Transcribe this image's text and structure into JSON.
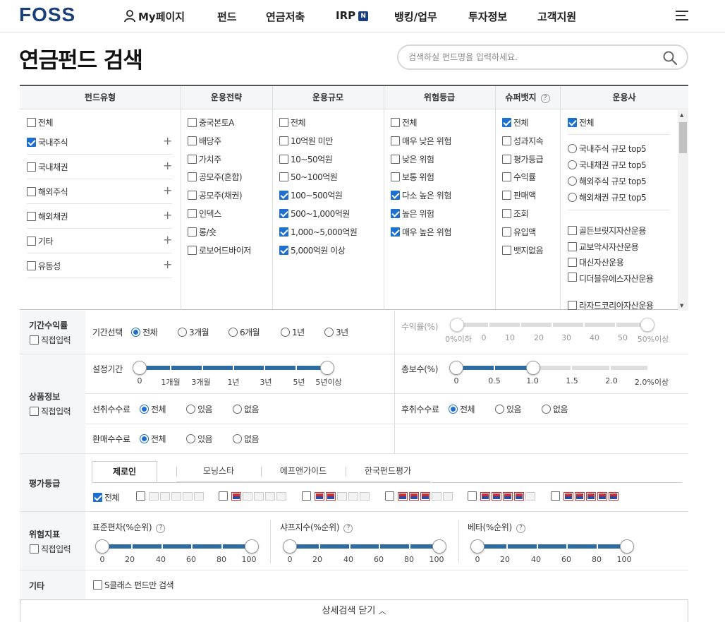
{
  "header": {
    "logo": "FOSS",
    "nav": [
      "My페이지",
      "펀드",
      "연금저축",
      "IRP",
      "뱅킹/업무",
      "투자정보",
      "고객지원"
    ],
    "irp_badge": "N"
  },
  "page": {
    "title": "연금펀드 검색",
    "search_placeholder": "검색하실 펀드명을 입력하세요."
  },
  "filters": {
    "headers": [
      "펀드유형",
      "운용전략",
      "운용규모",
      "위험등급",
      "슈퍼뱃지",
      "운용사"
    ],
    "help_mark": "?",
    "fund_type": [
      {
        "label": "전체",
        "checked": false
      },
      {
        "label": "국내주식",
        "checked": true
      },
      {
        "label": "국내채권",
        "checked": false
      },
      {
        "label": "해외주식",
        "checked": false
      },
      {
        "label": "해외채권",
        "checked": false
      },
      {
        "label": "기타",
        "checked": false
      },
      {
        "label": "유동성",
        "checked": false
      }
    ],
    "plus": "+",
    "strategy": [
      {
        "label": "중국본토A",
        "checked": false
      },
      {
        "label": "배당주",
        "checked": false
      },
      {
        "label": "가치주",
        "checked": false
      },
      {
        "label": "공모주(혼합)",
        "checked": false
      },
      {
        "label": "공모주(채권)",
        "checked": false
      },
      {
        "label": "인덱스",
        "checked": false
      },
      {
        "label": "롱/숏",
        "checked": false
      },
      {
        "label": "로보어드바이저",
        "checked": false
      }
    ],
    "size": [
      {
        "label": "전체",
        "checked": false
      },
      {
        "label": "10억원 미만",
        "checked": false
      },
      {
        "label": "10~50억원",
        "checked": false
      },
      {
        "label": "50~100억원",
        "checked": false
      },
      {
        "label": "100~500억원",
        "checked": true
      },
      {
        "label": "500~1,000억원",
        "checked": true
      },
      {
        "label": "1,000~5,000억원",
        "checked": true
      },
      {
        "label": "5,000억원 이상",
        "checked": true
      }
    ],
    "risk": [
      {
        "label": "전체",
        "checked": false
      },
      {
        "label": "매우 낮은 위험",
        "checked": false
      },
      {
        "label": "낮은 위험",
        "checked": false
      },
      {
        "label": "보통 위험",
        "checked": false
      },
      {
        "label": "다소 높은 위험",
        "checked": true
      },
      {
        "label": "높은 위험",
        "checked": true
      },
      {
        "label": "매우 높은 위험",
        "checked": true
      }
    ],
    "badge": [
      {
        "label": "전체",
        "checked": true
      },
      {
        "label": "성과지속",
        "checked": false
      },
      {
        "label": "평가등급",
        "checked": false
      },
      {
        "label": "수익률",
        "checked": false
      },
      {
        "label": "판매액",
        "checked": false
      },
      {
        "label": "조회",
        "checked": false
      },
      {
        "label": "유입액",
        "checked": false
      },
      {
        "label": "뱃지없음",
        "checked": false
      }
    ],
    "company_all": {
      "label": "전체",
      "checked": true
    },
    "company_top": [
      "국내주식 규모 top5",
      "국내채권 규모 top5",
      "해외주식 규모 top5",
      "해외채권 규모 top5"
    ],
    "company_list": [
      "골든브릿지자산운용",
      "교보악사자산운용",
      "대신자산운용",
      "디더블유에스자산운용",
      "라자드코리아자산운용"
    ]
  },
  "detail": {
    "period_return": {
      "label": "기간수익률",
      "direct": "직접입력",
      "select_label": "기간선택",
      "options": [
        "전체",
        "3개월",
        "6개월",
        "1년",
        "3년"
      ],
      "selected": "전체",
      "rate_label": "수익률(%)",
      "rate_ticks": [
        "0%이하",
        "0",
        "10",
        "20",
        "30",
        "40",
        "50",
        "50%이상"
      ]
    },
    "product": {
      "label": "상품정보",
      "direct": "직접입력",
      "period_label": "설정기간",
      "period_ticks": [
        "0",
        "1개월",
        "3개월",
        "1년",
        "3년",
        "5년",
        "5년이상"
      ],
      "fee_label": "총보수(%)",
      "fee_ticks": [
        "0",
        "0.5",
        "1.0",
        "1.5",
        "2.0",
        "2.0%이상"
      ],
      "fee_min": 0,
      "fee_max": 1.0,
      "front_label": "선취수수료",
      "back_label": "후취수수료",
      "redeem_label": "환매수수료",
      "fee_options": [
        "전체",
        "있음",
        "없음"
      ]
    },
    "rating": {
      "label": "평가등급",
      "tabs": [
        "제로인",
        "모닝스타",
        "에프앤가이드",
        "한국펀드평가"
      ],
      "active_tab": "제로인",
      "all_label": "전체",
      "all_checked": true,
      "star_levels": [
        1,
        2,
        3,
        4,
        5
      ]
    },
    "risk_index": {
      "label": "위험지표",
      "direct": "직접입력",
      "sliders": [
        "표준편차(%순위)",
        "샤프지수(%순위)",
        "베타(%순위)"
      ],
      "ticks": [
        "0",
        "20",
        "40",
        "60",
        "80",
        "100"
      ]
    },
    "etc": {
      "label": "기타",
      "sclass": "S클래스 펀드만 검색"
    },
    "close_button": "상세검색 닫기"
  }
}
